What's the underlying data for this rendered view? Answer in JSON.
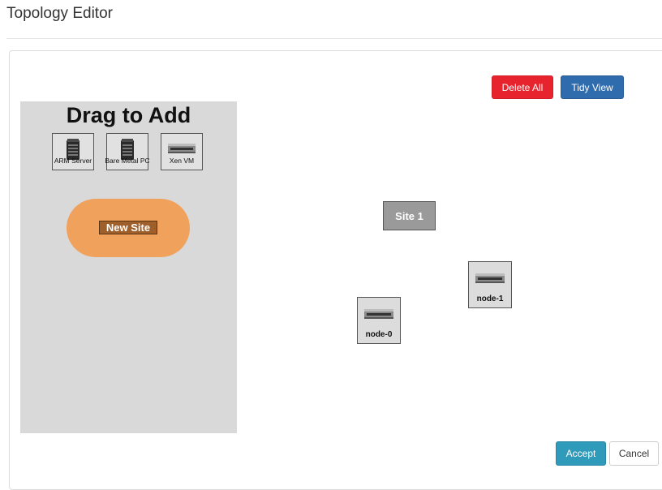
{
  "page": {
    "title": "Topology Editor"
  },
  "toolbar": {
    "delete_all_label": "Delete All",
    "tidy_view_label": "Tidy View"
  },
  "palette": {
    "title": "Drag to Add",
    "items": [
      {
        "label": "ARM Server",
        "icon": "server-tower-icon"
      },
      {
        "label": "Bare Metal PC",
        "icon": "server-tower-icon"
      },
      {
        "label": "Xen VM",
        "icon": "network-switch-icon"
      }
    ],
    "new_site_label": "New Site"
  },
  "canvas": {
    "sites": [
      {
        "label": "Site 1"
      }
    ],
    "nodes": [
      {
        "label": "node-0",
        "icon": "network-switch-icon"
      },
      {
        "label": "node-1",
        "icon": "network-switch-icon"
      }
    ]
  },
  "footer": {
    "accept_label": "Accept",
    "cancel_label": "Cancel"
  },
  "colors": {
    "delete_button": "#e7242d",
    "tidy_button": "#2f6cad",
    "accept_button": "#2f9ab9",
    "new_site": "#f0a25c",
    "site_box": "#9a9a9a",
    "palette_bg": "#d9d9d9"
  }
}
